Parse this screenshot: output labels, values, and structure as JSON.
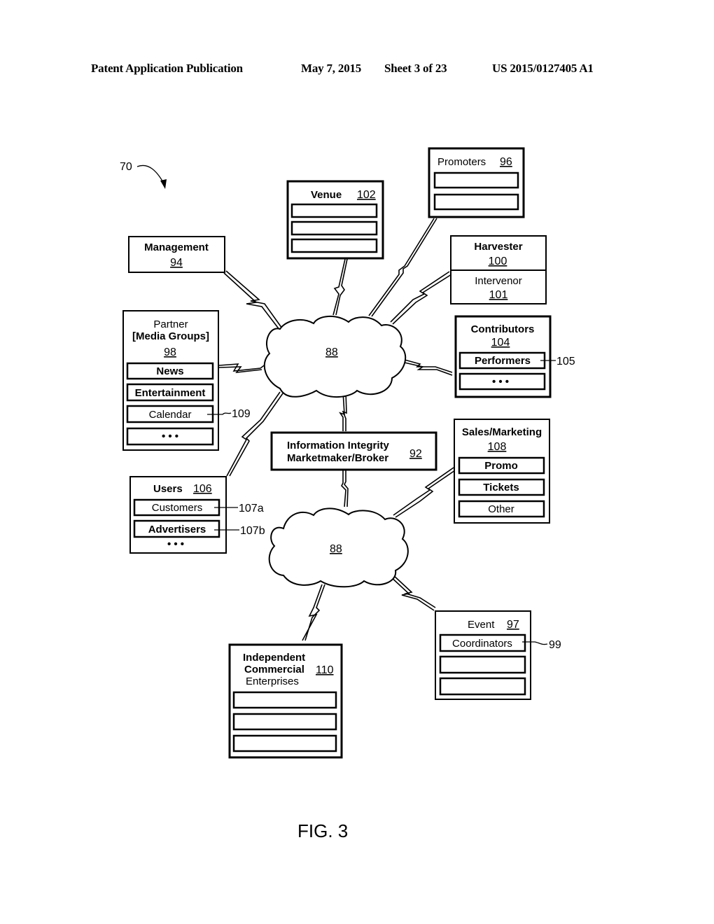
{
  "header": {
    "publication": "Patent Application Publication",
    "date": "May 7, 2015",
    "sheet": "Sheet 3 of 23",
    "number": "US 2015/0127405 A1"
  },
  "figure": {
    "label": "FIG. 3",
    "system_ref": "70"
  },
  "nodes": {
    "management": {
      "title": "Management",
      "ref": "94"
    },
    "venue": {
      "title": "Venue",
      "ref": "102",
      "slots": [
        "",
        "",
        ""
      ]
    },
    "promoters": {
      "title": "Promoters",
      "ref": "96",
      "slots": [
        "",
        ""
      ]
    },
    "harvester": {
      "title": "Harvester",
      "ref": "100"
    },
    "intervenor": {
      "title": "Intervenor",
      "ref": "101"
    },
    "partner": {
      "title_line1": "Partner",
      "title_line2": "[Media Groups]",
      "ref": "98",
      "items": [
        "News",
        "Entertainment",
        "Calendar",
        "• • •"
      ],
      "callout": "109"
    },
    "contributors": {
      "title": "Contributors",
      "ref": "104",
      "items": [
        "Performers",
        "• • •"
      ],
      "callout": "105"
    },
    "network_upper": {
      "ref": "88"
    },
    "broker": {
      "line1": "Information Integrity",
      "line2": "Marketmaker/Broker",
      "ref": "92"
    },
    "sales": {
      "title": "Sales/Marketing",
      "ref": "108",
      "items": [
        "Promo",
        "Tickets",
        "Other"
      ]
    },
    "users": {
      "title": "Users",
      "ref": "106",
      "items": [
        "Customers",
        "Advertisers"
      ],
      "more": "• • •",
      "callouts": [
        "107a",
        "107b"
      ]
    },
    "network_lower": {
      "ref": "88"
    },
    "event": {
      "title": "Event",
      "ref": "97",
      "items": [
        "Coordinators",
        "",
        ""
      ],
      "callout": "99"
    },
    "ice": {
      "line1": "Independent",
      "line2": "Commercial",
      "line3": "Enterprises",
      "ref": "110",
      "slots": [
        "",
        "",
        ""
      ]
    }
  }
}
